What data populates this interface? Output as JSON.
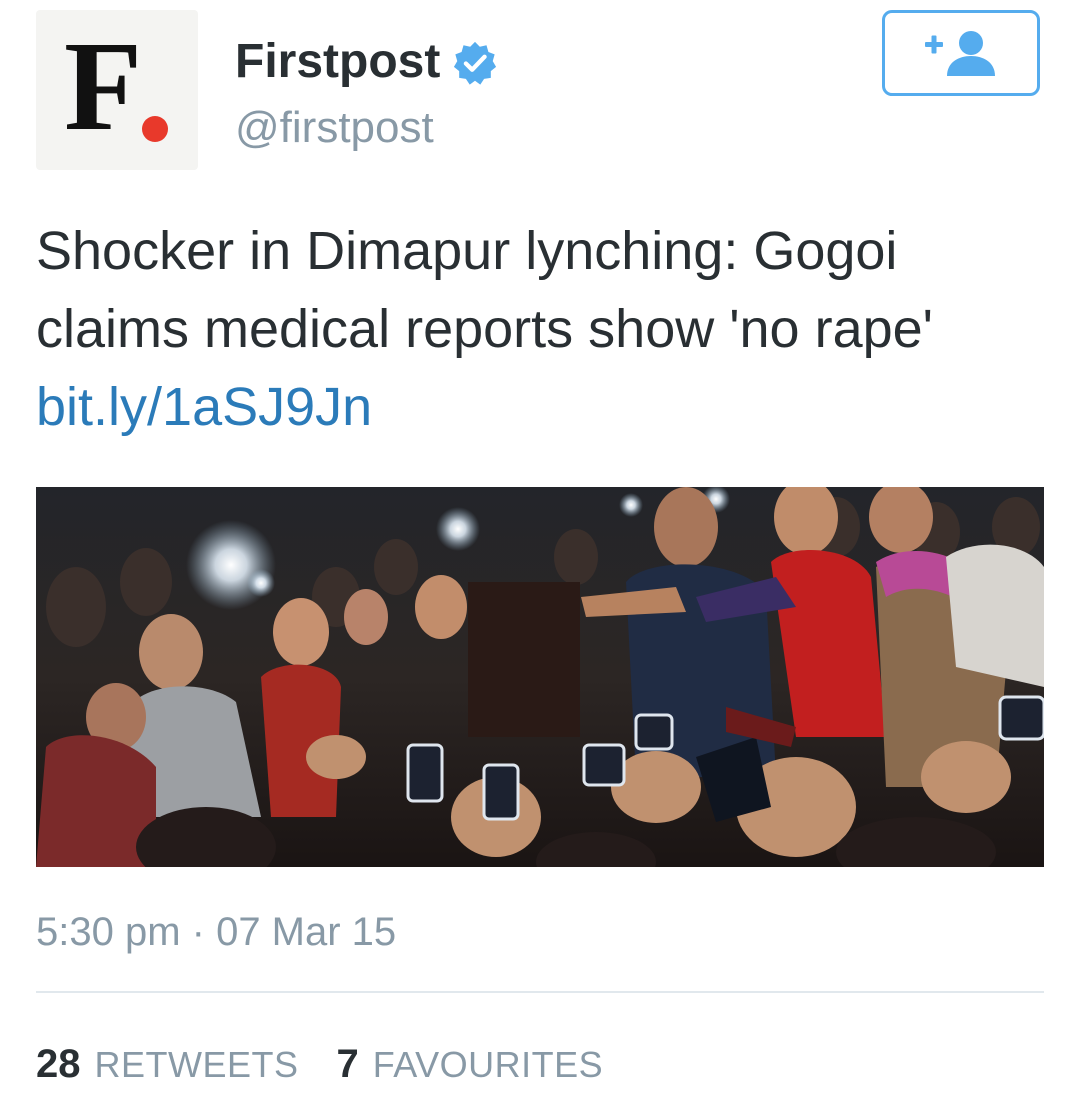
{
  "author": {
    "display_name": "Firstpost",
    "handle": "@firstpost",
    "verified": true,
    "avatar_letter": "F",
    "avatar_dot_color": "#e8392b"
  },
  "follow_button": {
    "icon": "add-user-icon",
    "color": "#55acee"
  },
  "tweet": {
    "text": "Shocker in Dimapur lynching: Gogoi claims medical reports show 'no rape'",
    "link": "bit.ly/1aSJ9Jn",
    "link_color": "#2b7bb9"
  },
  "media": {
    "kind": "photo",
    "description_icon": "crowd-photo"
  },
  "meta": {
    "timestamp": "5:30 pm · 07 Mar 15"
  },
  "stats": {
    "retweets_count": "28",
    "retweets_label": "RETWEETS",
    "favourites_count": "7",
    "favourites_label": "FAVOURITES"
  }
}
